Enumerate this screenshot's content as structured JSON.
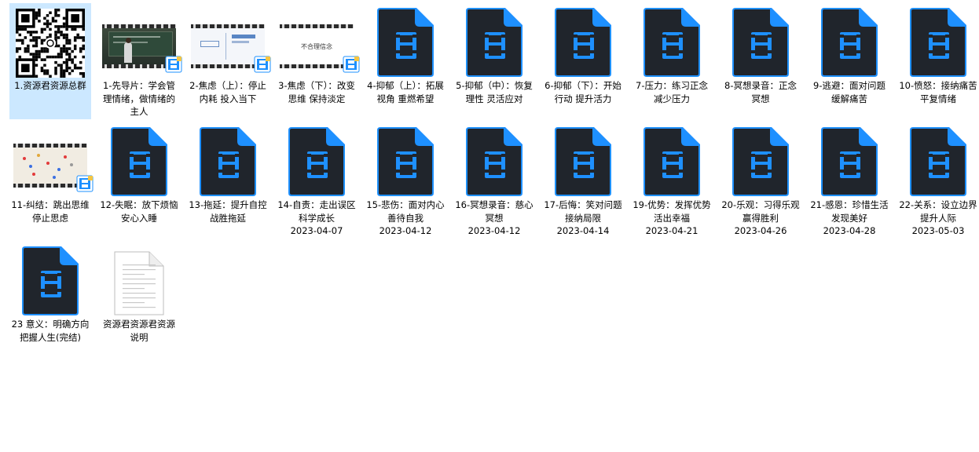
{
  "files": [
    {
      "kind": "qr",
      "label": "1.资源君资源总群",
      "date": ""
    },
    {
      "kind": "frame",
      "scene": "classroom",
      "label": "1-先导片：学会管理情绪，做情绪的主人",
      "date": ""
    },
    {
      "kind": "frame",
      "scene": "slide",
      "label": "2-焦虑（上）：停止内耗 投入当下",
      "date": ""
    },
    {
      "kind": "frame",
      "scene": "text",
      "scene_text": "不合理信念",
      "label": "3-焦虑（下）：改变思维 保持淡定",
      "date": ""
    },
    {
      "kind": "video",
      "label": "4-抑郁（上）：拓展视角 重燃希望",
      "date": ""
    },
    {
      "kind": "video",
      "label": "5-抑郁（中）：恢复理性 灵活应对",
      "date": ""
    },
    {
      "kind": "video",
      "label": "6-抑郁（下）：开始行动 提升活力",
      "date": ""
    },
    {
      "kind": "video",
      "label": "7-压力：练习正念 减少压力",
      "date": ""
    },
    {
      "kind": "video",
      "label": "8-冥想录音：正念冥想",
      "date": ""
    },
    {
      "kind": "video",
      "label": "9-逃避：面对问题 缓解痛苦",
      "date": ""
    },
    {
      "kind": "video",
      "label": "10-愤怒：接纳痛苦 平复情绪",
      "date": ""
    },
    {
      "kind": "frame",
      "scene": "dots",
      "label": "11-纠结：跳出思维 停止思虑",
      "date": ""
    },
    {
      "kind": "video",
      "label": "12-失眠：放下烦恼 安心入睡",
      "date": ""
    },
    {
      "kind": "video",
      "label": "13-拖延：提升自控 战胜拖延",
      "date": ""
    },
    {
      "kind": "video",
      "label": "14-自责：走出误区 科学成长",
      "date": "2023-04-07"
    },
    {
      "kind": "video",
      "label": "15-悲伤：面对内心 善待自我",
      "date": "2023-04-12"
    },
    {
      "kind": "video",
      "label": "16-冥想录音：慈心冥想",
      "date": "2023-04-12"
    },
    {
      "kind": "video",
      "label": "17-后悔：笑对问题 接纳局限",
      "date": "2023-04-14"
    },
    {
      "kind": "video",
      "label": "19-优势：发挥优势 活出幸福",
      "date": "2023-04-21"
    },
    {
      "kind": "video",
      "label": "20-乐观：习得乐观 赢得胜利",
      "date": "2023-04-26"
    },
    {
      "kind": "video",
      "label": "21-感恩：珍惜生活 发现美好",
      "date": "2023-04-28"
    },
    {
      "kind": "video",
      "label": "22-关系：设立边界 提升人际",
      "date": "2023-05-03"
    },
    {
      "kind": "video",
      "label": "23 意义：明确方向 把握人生(完结)",
      "date": ""
    },
    {
      "kind": "doc",
      "label": "资源君资源君资源说明",
      "date": ""
    }
  ],
  "colors": {
    "selection": "#cce8ff",
    "video_icon_body": "#1f2329",
    "video_icon_accent": "#1e90ff"
  }
}
